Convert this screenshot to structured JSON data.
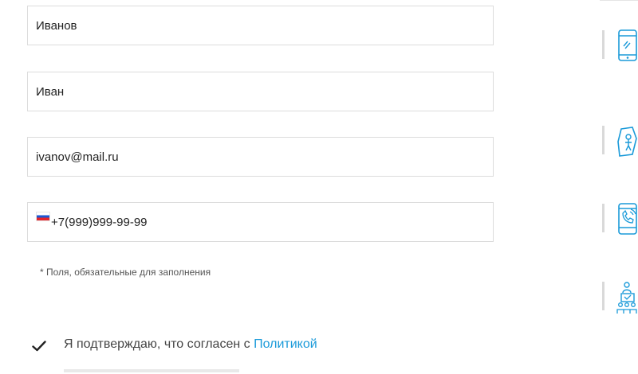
{
  "form": {
    "last_name_value": "Иванов",
    "first_name_value": "Иван",
    "email_value": "ivanov@mail.ru",
    "phone_value": "+7(999)999-99-99",
    "required_note": "* Поля, обязательные для заполнения",
    "consent_text": "Я подтверждаю, что согласен с ",
    "policy_link": "Политикой",
    "checkbox_checked": true
  },
  "sidebar": {
    "icons": [
      "phone-icon",
      "delivery-person-icon",
      "mobile-payment-icon",
      "people-group-icon"
    ]
  },
  "colors": {
    "link": "#1a9ad9",
    "icon": "#1a9ad9",
    "border": "#dcdcdc"
  }
}
